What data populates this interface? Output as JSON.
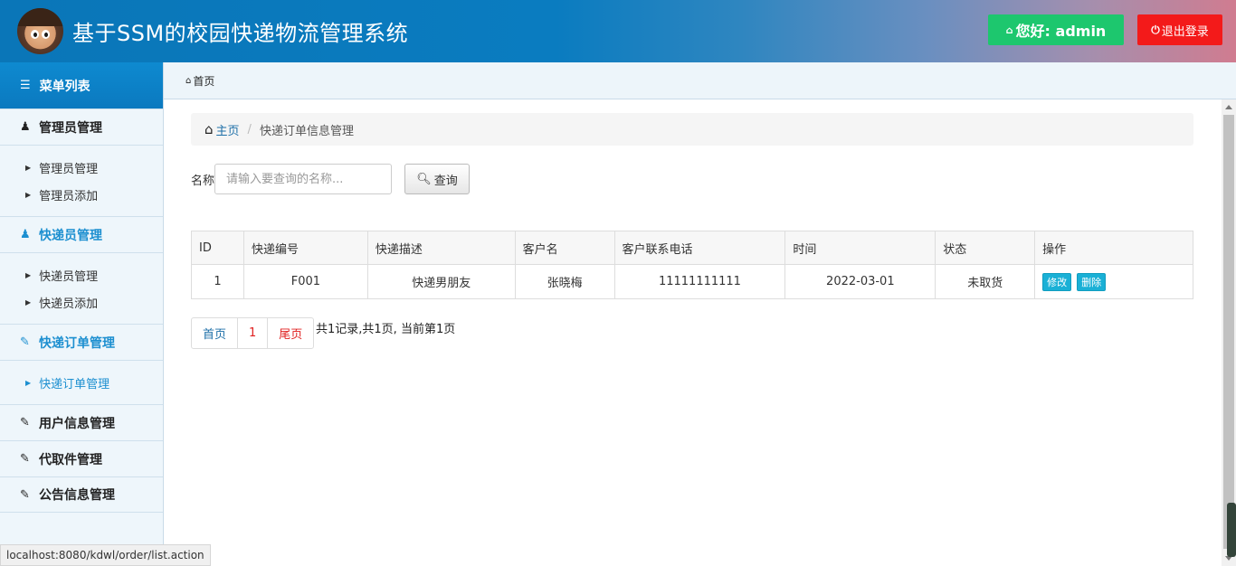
{
  "header": {
    "title": "基于SSM的校园快递物流管理系统",
    "greeting": "您好: admin",
    "logout": "退出登录"
  },
  "sidebar": {
    "heading": "菜单列表",
    "groups": [
      {
        "label": "管理员管理",
        "icon": "user-icon",
        "items": [
          "管理员管理",
          "管理员添加"
        ]
      },
      {
        "label": "快递员管理",
        "icon": "user-icon",
        "items": [
          "快递员管理",
          "快递员添加"
        ]
      },
      {
        "label": "快递订单管理",
        "icon": "edit-icon",
        "items": [
          "快递订单管理"
        ]
      },
      {
        "label": "用户信息管理",
        "icon": "edit-icon",
        "items": []
      },
      {
        "label": "代取件管理",
        "icon": "edit-icon",
        "items": []
      },
      {
        "label": "公告信息管理",
        "icon": "edit-icon",
        "items": []
      }
    ]
  },
  "top_crumb": "首页",
  "breadcrumb": {
    "home": "主页",
    "current": "快递订单信息管理"
  },
  "search": {
    "label": "名称",
    "placeholder": "请输入要查询的名称...",
    "button": "查询"
  },
  "table": {
    "headers": [
      "ID",
      "快递编号",
      "快递描述",
      "客户名",
      "客户联系电话",
      "时间",
      "状态",
      "操作"
    ],
    "rows": [
      {
        "id": "1",
        "code": "F001",
        "desc": "快递男朋友",
        "customer": "张晓梅",
        "phone": "11111111111",
        "time": "2022-03-01",
        "status": "未取货",
        "edit": "修改",
        "delete": "删除"
      }
    ]
  },
  "pager": {
    "first": "首页",
    "page": "1",
    "last": "尾页",
    "info": "共1记录,共1页, 当前第1页"
  },
  "statusbar": "localhost:8080/kdwl/order/list.action",
  "colors": {
    "header_blue": "#0a76b8",
    "greet_green": "#1dc76e",
    "logout_red": "#f31a1a",
    "active_blue": "#1c8fd0",
    "btn_cyan": "#1ab0d6"
  }
}
